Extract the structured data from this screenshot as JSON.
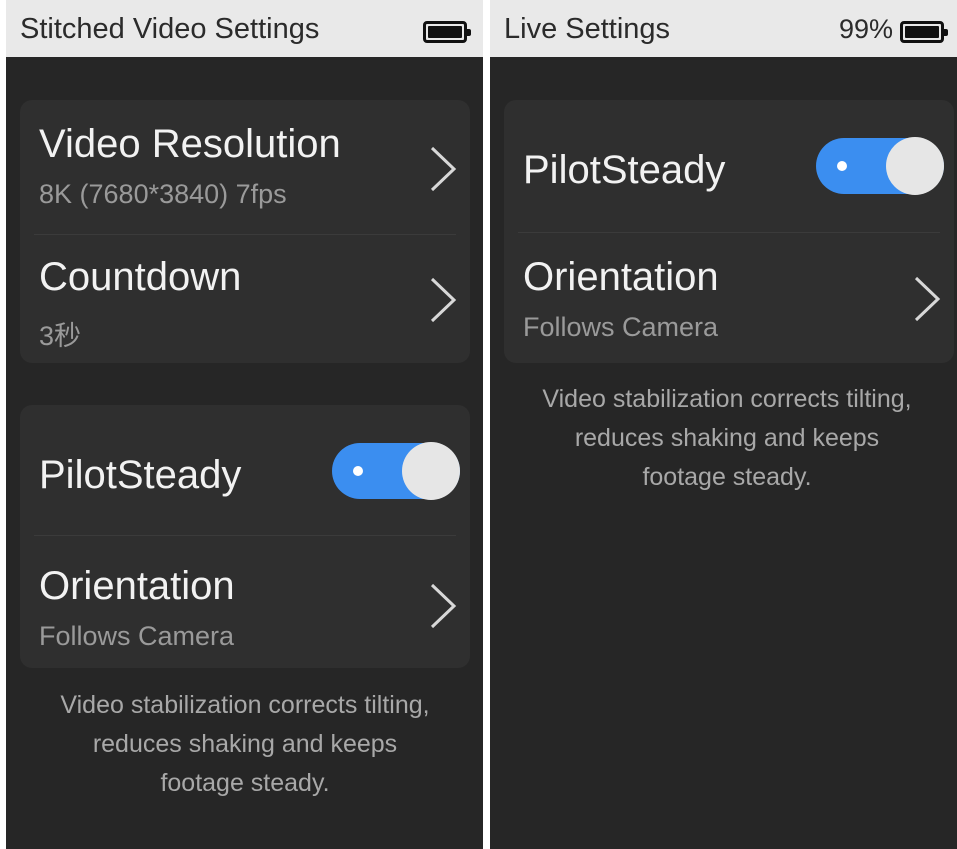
{
  "left_panel": {
    "title": "Stitched Video Settings",
    "resolution": {
      "label": "Video Resolution",
      "value": "8K (7680*3840)  7fps"
    },
    "countdown": {
      "label": "Countdown",
      "value": "3秒"
    },
    "pilotsteady": {
      "label": "PilotSteady",
      "enabled": true
    },
    "orientation": {
      "label": "Orientation",
      "value": "Follows Camera"
    },
    "note": "Video stabilization corrects tilting, reduces shaking and keeps footage steady."
  },
  "right_panel": {
    "title": "Live Settings",
    "battery_percent": "99%",
    "pilotsteady": {
      "label": "PilotSteady",
      "enabled": true
    },
    "orientation": {
      "label": "Orientation",
      "value": "Follows Camera"
    },
    "note": "Video stabilization corrects tilting, reduces shaking and keeps footage steady."
  },
  "colors": {
    "accent": "#3b8ef0",
    "background": "#262626",
    "card": "#2f2f2f",
    "status_bar": "#e9e9e9"
  }
}
